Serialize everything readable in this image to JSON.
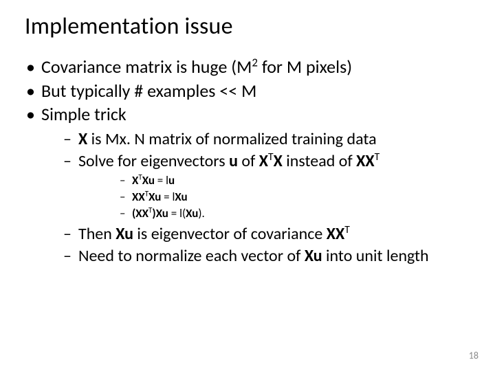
{
  "title": "Implementation issue",
  "b1": "Covariance matrix is huge (M",
  "b1_sup": "2",
  "b1_tail": " for M pixels)",
  "b2": "But typically # examples << M",
  "b3": "Simple trick",
  "s1_a": "X",
  "s1_b": " is Mx. N matrix of normalized training data",
  "s2_a": "Solve for eigenvectors ",
  "s2_u": "u",
  "s2_b": " of ",
  "s2_c": "X",
  "s2_cT": "T",
  "s2_d": "X",
  "s2_e": " instead of ",
  "s2_f": "XX",
  "s2_fT": "T",
  "e1_a": "X",
  "e1_T": "T",
  "e1_b": "Xu",
  "e1_eq": " = l",
  "e1_u": "u",
  "e2_a": "XX",
  "e2_T": "T",
  "e2_b": "Xu",
  "e2_eq": " = l",
  "e2_c": "Xu",
  "e3_a": "(XX",
  "e3_T": "T",
  "e3_b": ")Xu",
  "e3_eq": " = l(",
  "e3_c": "Xu",
  "e3_d": "). ",
  "s3_a": "Then ",
  "s3_b": "Xu",
  "s3_c": " is eigenvector of covariance ",
  "s3_d": "XX",
  "s3_dT": "T",
  "s4_a": "Need to normalize each vector of  ",
  "s4_b": "Xu",
  "s4_c": " into unit length",
  "page": "18"
}
